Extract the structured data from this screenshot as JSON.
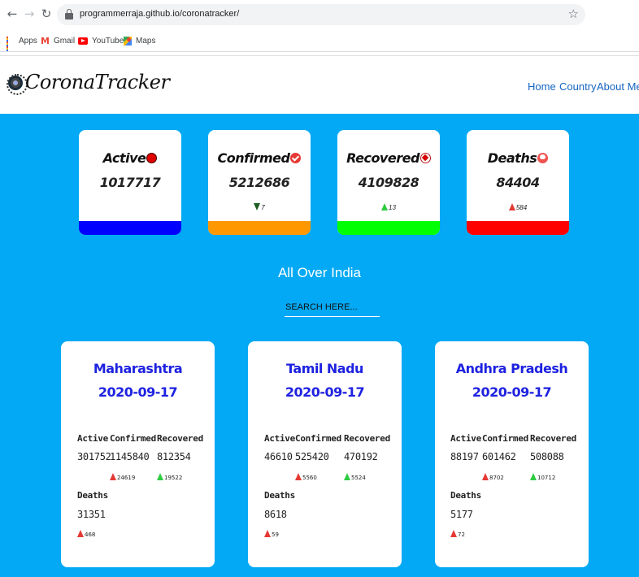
{
  "browser": {
    "url": "programmerraja.github.io/coronatracker/",
    "bookmarks": [
      {
        "label": "Apps",
        "icon": "apps-grid-icon"
      },
      {
        "label": "Gmail",
        "icon": "gmail-icon"
      },
      {
        "label": "YouTube",
        "icon": "youtube-icon"
      },
      {
        "label": "Maps",
        "icon": "maps-icon"
      }
    ]
  },
  "site": {
    "brand": "CoronaTracker",
    "nav": [
      "Home",
      "Country",
      "About Me"
    ]
  },
  "totals": [
    {
      "title": "Active",
      "value": "1017717",
      "delta": "",
      "trend": "none",
      "bar_color": "#0000ff",
      "icon": "red-dot-icon"
    },
    {
      "title": "Confirmed",
      "value": "5212686",
      "delta": "7",
      "trend": "down",
      "bar_color": "#ff9800",
      "icon": "check-badge-icon"
    },
    {
      "title": "Recovered",
      "value": "4109828",
      "delta": "13",
      "trend": "up",
      "bar_color": "#00ff00",
      "icon": "heart-icon"
    },
    {
      "title": "Deaths",
      "value": "84404",
      "delta": "584",
      "trend": "up",
      "bar_color": "#ff0000",
      "icon": "skull-icon"
    }
  ],
  "section_title": "All Over India",
  "search": {
    "placeholder": "SEARCH HERE...",
    "value": ""
  },
  "labels": {
    "active": "Active",
    "confirmed": "Confirmed",
    "recovered": "Recovered",
    "deaths": "Deaths"
  },
  "states": [
    {
      "name": "Maharashtra",
      "date": "2020-09-17",
      "active": "301752",
      "confirmed": "1145840",
      "confirmed_delta": "24619",
      "recovered": "812354",
      "recovered_delta": "19522",
      "deaths": "31351",
      "deaths_delta": "468"
    },
    {
      "name": "Tamil Nadu",
      "date": "2020-09-17",
      "active": "46610",
      "confirmed": "525420",
      "confirmed_delta": "5560",
      "recovered": "470192",
      "recovered_delta": "5524",
      "deaths": "8618",
      "deaths_delta": "59"
    },
    {
      "name": "Andhra Pradesh",
      "date": "2020-09-17",
      "active": "88197",
      "confirmed": "601462",
      "confirmed_delta": "8702",
      "recovered": "508088",
      "recovered_delta": "10712",
      "deaths": "5177",
      "deaths_delta": "72"
    }
  ],
  "colors": {
    "page_bg": "#03a9f4",
    "state_text": "#1e22e0",
    "nav_link": "#1565c0"
  }
}
